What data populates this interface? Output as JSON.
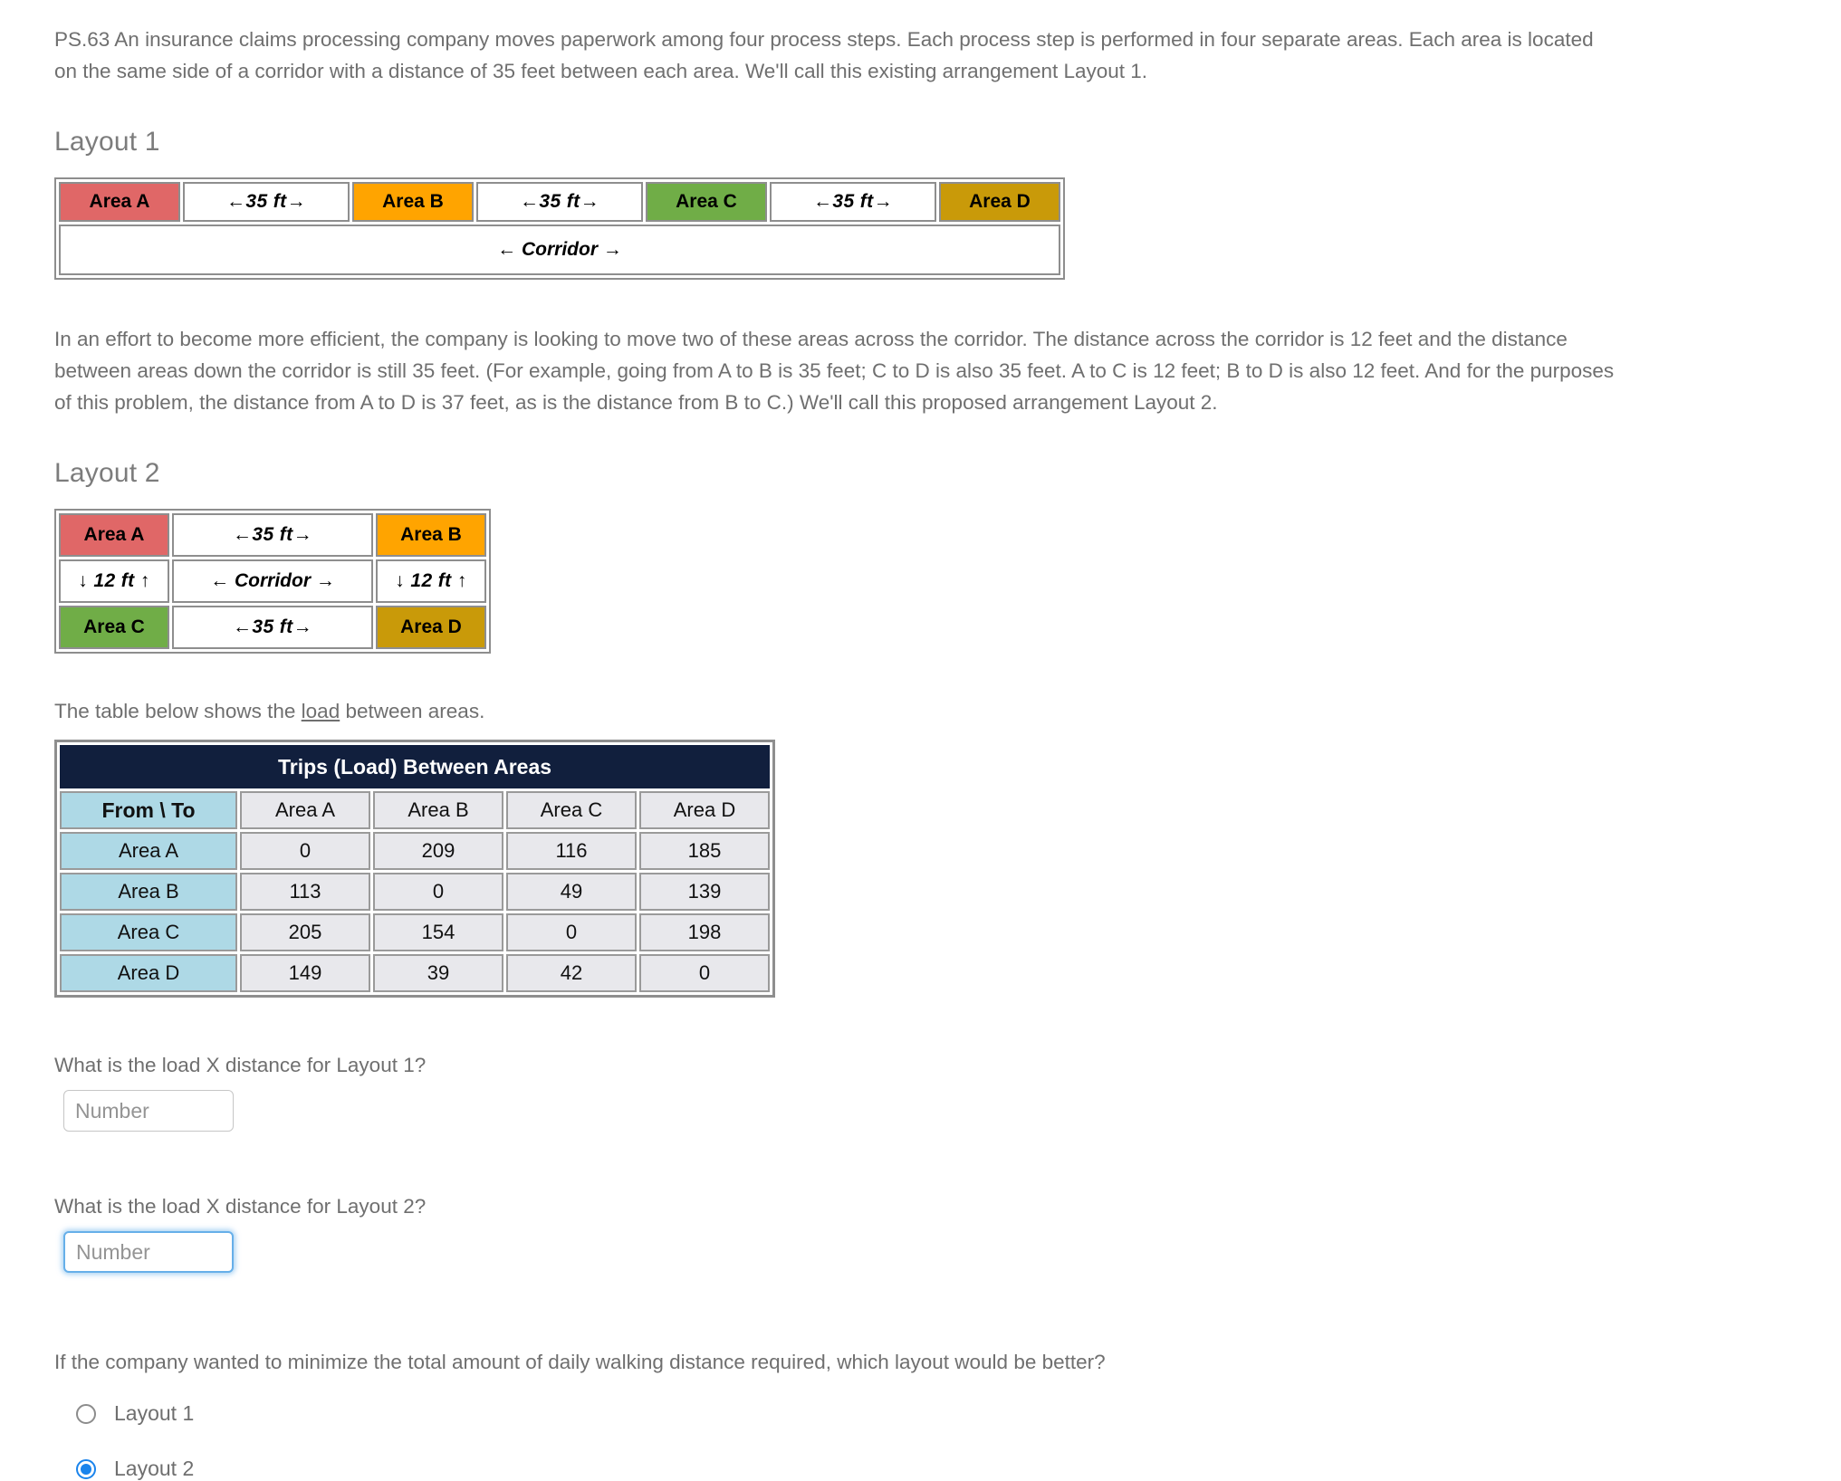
{
  "intro_paragraph": "PS.63 An insurance claims processing company moves paperwork among four process steps. Each process step is performed in four separate areas. Each area is located on the same side of a corridor with a distance of 35 feet between each area. We'll call this existing arrangement Layout 1.",
  "layout1": {
    "heading": "Layout 1",
    "cells": [
      {
        "label": "Area A",
        "kind": "area",
        "color": "#e06767"
      },
      {
        "label": "←35 ft→",
        "kind": "gap"
      },
      {
        "label": "Area B",
        "kind": "area",
        "color": "#ffa400"
      },
      {
        "label": "←35 ft→",
        "kind": "gap"
      },
      {
        "label": "Area C",
        "kind": "area",
        "color": "#70ad47"
      },
      {
        "label": "←35 ft→",
        "kind": "gap"
      },
      {
        "label": "Area D",
        "kind": "area",
        "color": "#c99a09"
      }
    ],
    "corridor": "← Corridor →"
  },
  "mid_paragraph": "In an effort to become more efficient, the company is looking to move two of these areas across the corridor. The distance across the corridor is 12 feet and the distance between areas down the corridor is still 35 feet. (For example, going from A to B is 35 feet; C to D is also 35 feet. A to C is 12 feet; B to D is also 12 feet. And for the purposes of this problem, the distance from A to D is 37 feet, as is the distance from B to C.) We'll call this proposed arrangement Layout 2.",
  "layout2": {
    "heading": "Layout 2",
    "row_top": {
      "left": "Area A",
      "mid": "←35 ft→",
      "right": "Area B"
    },
    "row_middle": {
      "left": "↓ 12 ft ↑",
      "mid": "← Corridor →",
      "right": "↓ 12 ft ↑"
    },
    "row_bottom": {
      "left": "Area C",
      "mid": "←35 ft→",
      "right": "Area D"
    }
  },
  "table_caption": {
    "before": "The table below shows the ",
    "link": "load",
    "after": " between areas."
  },
  "load_table": {
    "title": "Trips (Load) Between Areas",
    "corner_header": "From \\ To",
    "column_headers": [
      "Area A",
      "Area B",
      "Area C",
      "Area D"
    ],
    "rows": [
      {
        "label": "Area A",
        "values": [
          0,
          209,
          116,
          185
        ]
      },
      {
        "label": "Area B",
        "values": [
          113,
          0,
          49,
          139
        ]
      },
      {
        "label": "Area C",
        "values": [
          205,
          154,
          0,
          198
        ]
      },
      {
        "label": "Area D",
        "values": [
          149,
          39,
          42,
          0
        ]
      }
    ]
  },
  "questions": {
    "q1": {
      "text": "What is the load X distance for Layout 1?",
      "value": "",
      "placeholder": "Number"
    },
    "q2": {
      "text": "What is the load X distance for Layout 2?",
      "value": "",
      "placeholder": "Number"
    },
    "q3": {
      "text": "If the company wanted to minimize the total amount of daily walking distance required, which layout would be better?",
      "options": [
        {
          "label": "Layout 1",
          "checked": false
        },
        {
          "label": "Layout 2",
          "checked": true
        }
      ]
    }
  },
  "colors": {
    "text": "#6f6f6f",
    "table_header_navy": "#111f3d",
    "table_header_blue": "#aed9e6",
    "table_cell_gray": "#e8e8ec",
    "focus_blue": "#66afe9",
    "radio_blue": "#1a84ec"
  }
}
